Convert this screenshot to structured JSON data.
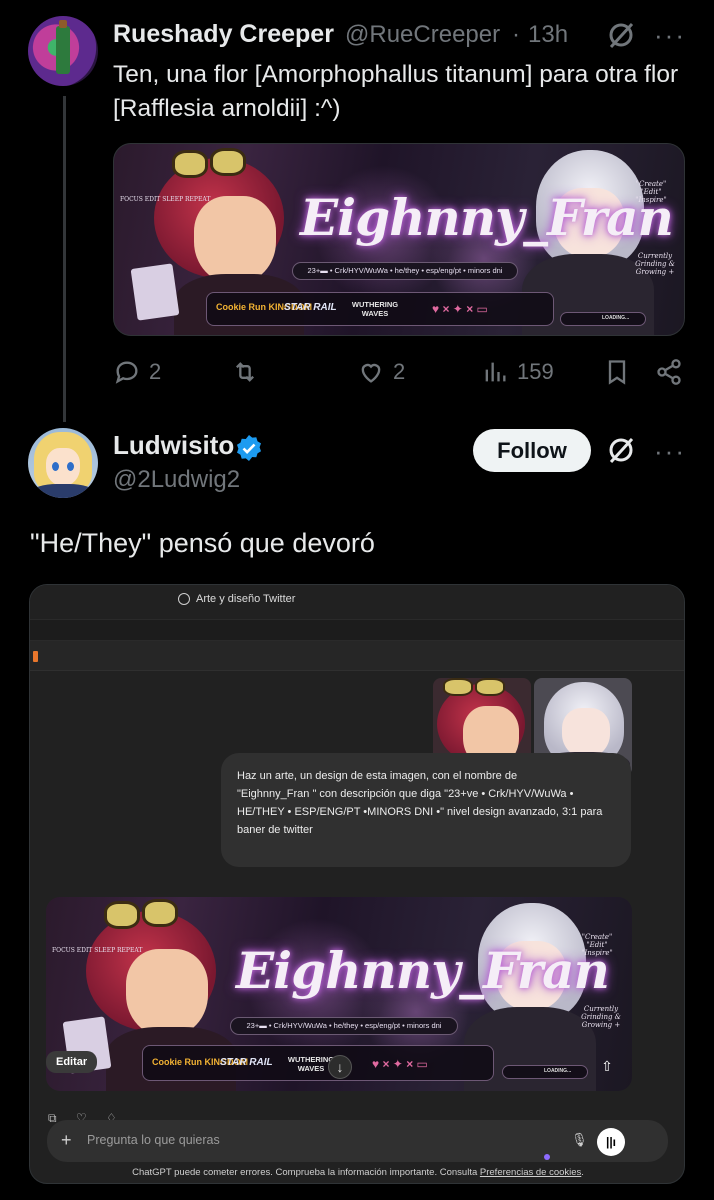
{
  "tweet1": {
    "name": "Rueshady Creeper",
    "handle": "@RueCreeper",
    "separator": "·",
    "time": "13h",
    "text": "Ten, una flor [Amorphophallus titanum] para otra flor [Rafflesia arnoldii] :^)",
    "more": "···",
    "actions": {
      "replies": "2",
      "retweets": "",
      "likes": "2",
      "views": "159"
    }
  },
  "banner": {
    "title": "Eighnny_Fran",
    "tagline": "23+▬ • Crk/HYV/WuWa • he/they • esp/eng/pt • minors dni",
    "logos": [
      "Cookie Run KINGDOM",
      "STAR RAIL",
      "WUTHERING WAVES"
    ],
    "right_note_1": "\"Create\" \"Edit\" \"Inspire\"",
    "right_note_2": "Currently Grinding & Growing +",
    "left_note": "FOCUS EDIT SLEEP REPEAT",
    "loading": "LOADING..."
  },
  "tweet2": {
    "name": "Ludwisito",
    "handle": "@2Ludwig2",
    "follow_label": "Follow",
    "text": "\"He/They\" pensó que devoró",
    "more": "···"
  },
  "chatgpt": {
    "window_title": "Arte y diseño Twitter",
    "prompt_lines": [
      "Haz un arte, un design de esta imagen, con el nombre de",
      "\"Eighnny_Fran \" con descripción que diga \"23+ve • Crk/HYV/WuWa •",
      "HE/THEY • ESP/ENG/PT •MINORS DNI •\" nivel design avanzado, 3:1 para",
      "baner de twitter"
    ],
    "edit_label": "Editar",
    "composer_placeholder": "Pregunta lo que quieras",
    "footer_text": "ChatGPT puede cometer errores. Comprueba la información importante. Consulta",
    "footer_link": "Preferencias de cookies",
    "footer_end": "."
  },
  "colors": {
    "bg": "#000000",
    "text": "#e7e9ea",
    "muted": "#71767b",
    "verified": "#1d9bf0",
    "follow_bg": "#eff3f4"
  }
}
